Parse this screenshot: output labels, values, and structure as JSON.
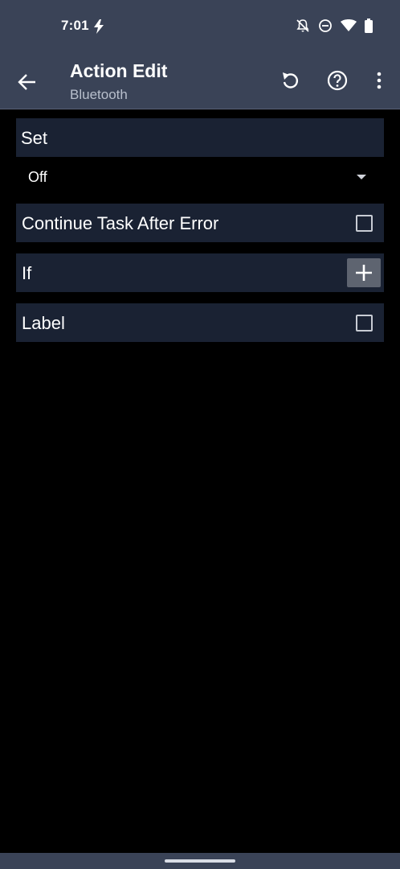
{
  "status_bar": {
    "time": "7:01",
    "icons": [
      "bolt-icon",
      "notifications-off-icon",
      "do-not-disturb-icon",
      "wifi-icon",
      "battery-icon"
    ]
  },
  "app_bar": {
    "title": "Action Edit",
    "subtitle": "Bluetooth",
    "actions": [
      "back-arrow-icon",
      "undo-icon",
      "help-icon",
      "more-vert-icon"
    ]
  },
  "form": {
    "set_label": "Set",
    "set_value": "Off",
    "continue_label": "Continue Task After Error",
    "continue_checked": false,
    "if_label": "If",
    "label_label": "Label",
    "label_checked": false
  },
  "colors": {
    "bar": "#3a4357",
    "row": "#1a2233",
    "background": "#000000"
  }
}
